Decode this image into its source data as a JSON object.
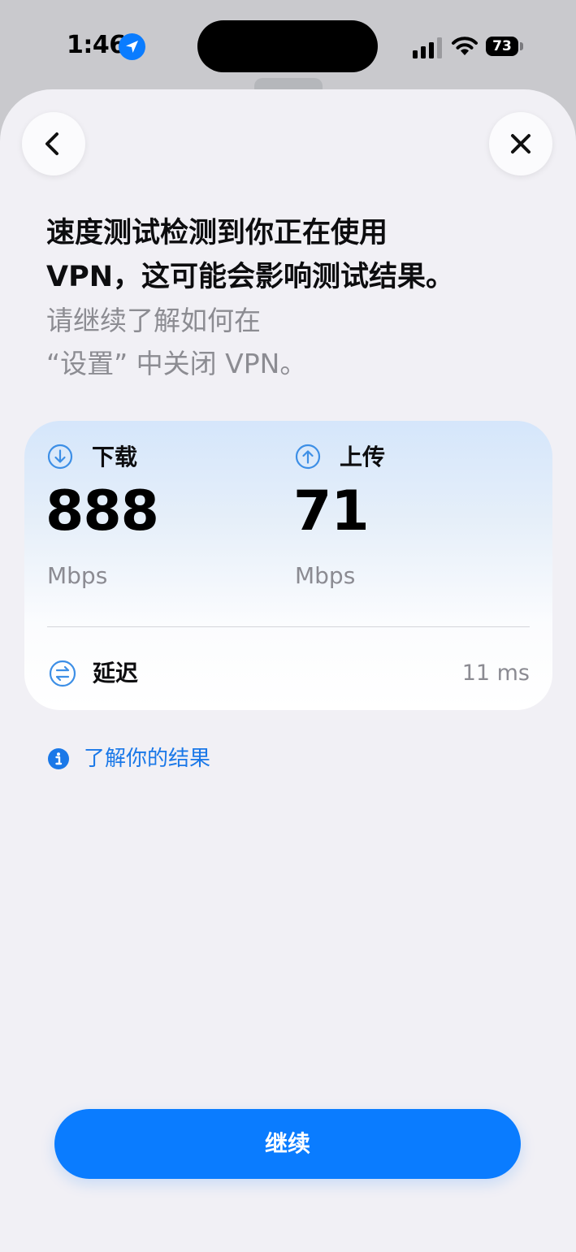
{
  "status_bar": {
    "time": "1:46",
    "battery": "73",
    "battery_level": 0.73,
    "icons": [
      "location-arrow-icon",
      "cellular-signal-icon",
      "wifi-icon",
      "battery-icon"
    ]
  },
  "nav": {
    "back_icon": "chevron-left-icon",
    "close_icon": "close-icon"
  },
  "heading": {
    "line1": "速度测试检测到你正在使用",
    "line2": "VPN，这可能会影响测试结果。"
  },
  "subtext": {
    "line1": "请继续了解如何在",
    "line2": "“设置” 中关闭 VPN。"
  },
  "results": {
    "download": {
      "label": "下载",
      "value": "888",
      "unit": "Mbps",
      "icon": "arrow-down-circle-icon"
    },
    "upload": {
      "label": "上传",
      "value": "71",
      "unit": "Mbps",
      "icon": "arrow-up-circle-icon"
    },
    "latency": {
      "label": "延迟",
      "value": "11 ms",
      "icon": "arrows-swap-circle-icon"
    }
  },
  "learn_more": {
    "label": "了解你的结果",
    "icon": "info-circle-icon"
  },
  "continue_button": {
    "label": "继续"
  },
  "colors": {
    "accent": "#0a7cff",
    "link": "#1a78e8",
    "sheet_background": "#f1f0f5"
  }
}
